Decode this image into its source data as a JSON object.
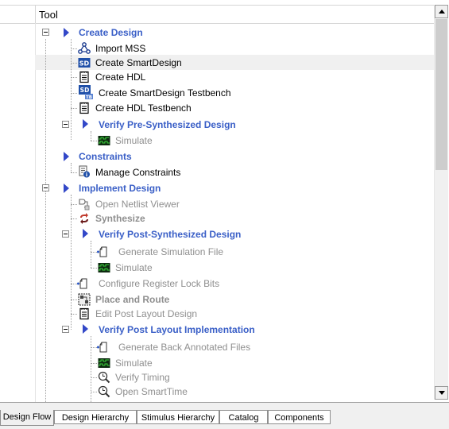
{
  "header": {
    "column_title": "Tool"
  },
  "tree": [
    {
      "label": "Create Design",
      "kind": "group",
      "icon": "play-icon",
      "expander": true
    },
    {
      "label": "Import MSS",
      "kind": "item",
      "icon": "mss-import-icon"
    },
    {
      "label": "Create SmartDesign",
      "kind": "item",
      "icon": "smartdesign-icon",
      "selected": true
    },
    {
      "label": "Create HDL",
      "kind": "item",
      "icon": "document-icon"
    },
    {
      "label": "Create SmartDesign Testbench",
      "kind": "item",
      "icon": "smartdesign-testbench-icon"
    },
    {
      "label": "Create HDL Testbench",
      "kind": "item",
      "icon": "document-icon"
    },
    {
      "label": "Verify Pre-Synthesized Design",
      "kind": "group",
      "icon": "play-icon",
      "expander": true
    },
    {
      "label": "Simulate",
      "kind": "disabled",
      "icon": "waveform-icon"
    },
    {
      "label": "Constraints",
      "kind": "group",
      "icon": "play-icon"
    },
    {
      "label": "Manage Constraints",
      "kind": "item",
      "icon": "constraints-info-icon"
    },
    {
      "label": "Implement Design",
      "kind": "group",
      "icon": "play-icon",
      "expander": true
    },
    {
      "label": "Open Netlist Viewer",
      "kind": "disabled",
      "icon": "netlist-icon"
    },
    {
      "label": "Synthesize",
      "kind": "disabled-bold",
      "icon": "synthesize-icon"
    },
    {
      "label": "Verify Post-Synthesized Design",
      "kind": "group",
      "icon": "play-icon",
      "expander": true
    },
    {
      "label": "Generate Simulation File",
      "kind": "disabled",
      "icon": "file-icon"
    },
    {
      "label": "Simulate",
      "kind": "disabled",
      "icon": "waveform-icon"
    },
    {
      "label": "Configure Register Lock Bits",
      "kind": "disabled",
      "icon": "file-icon"
    },
    {
      "label": "Place and Route",
      "kind": "disabled-bold",
      "icon": "place-route-icon"
    },
    {
      "label": "Edit Post Layout Design",
      "kind": "disabled",
      "icon": "document-icon"
    },
    {
      "label": "Verify Post Layout Implementation",
      "kind": "group",
      "icon": "play-icon",
      "expander": true
    },
    {
      "label": "Generate Back Annotated Files",
      "kind": "disabled",
      "icon": "file-icon"
    },
    {
      "label": "Simulate",
      "kind": "disabled",
      "icon": "waveform-icon"
    },
    {
      "label": "Verify Timing",
      "kind": "disabled",
      "icon": "timing-icon"
    },
    {
      "label": "Open SmartTime",
      "kind": "disabled",
      "icon": "timing-icon"
    }
  ],
  "tabs": [
    {
      "label": "Design Flow",
      "active": true
    },
    {
      "label": "Design Hierarchy",
      "active": false
    },
    {
      "label": "Stimulus Hierarchy",
      "active": false
    },
    {
      "label": "Catalog",
      "active": false
    },
    {
      "label": "Components",
      "active": false
    }
  ],
  "colors": {
    "group_text": "#3a5fc7",
    "disabled_text": "#8f8f8f",
    "play_arrow": "#3348c8"
  }
}
